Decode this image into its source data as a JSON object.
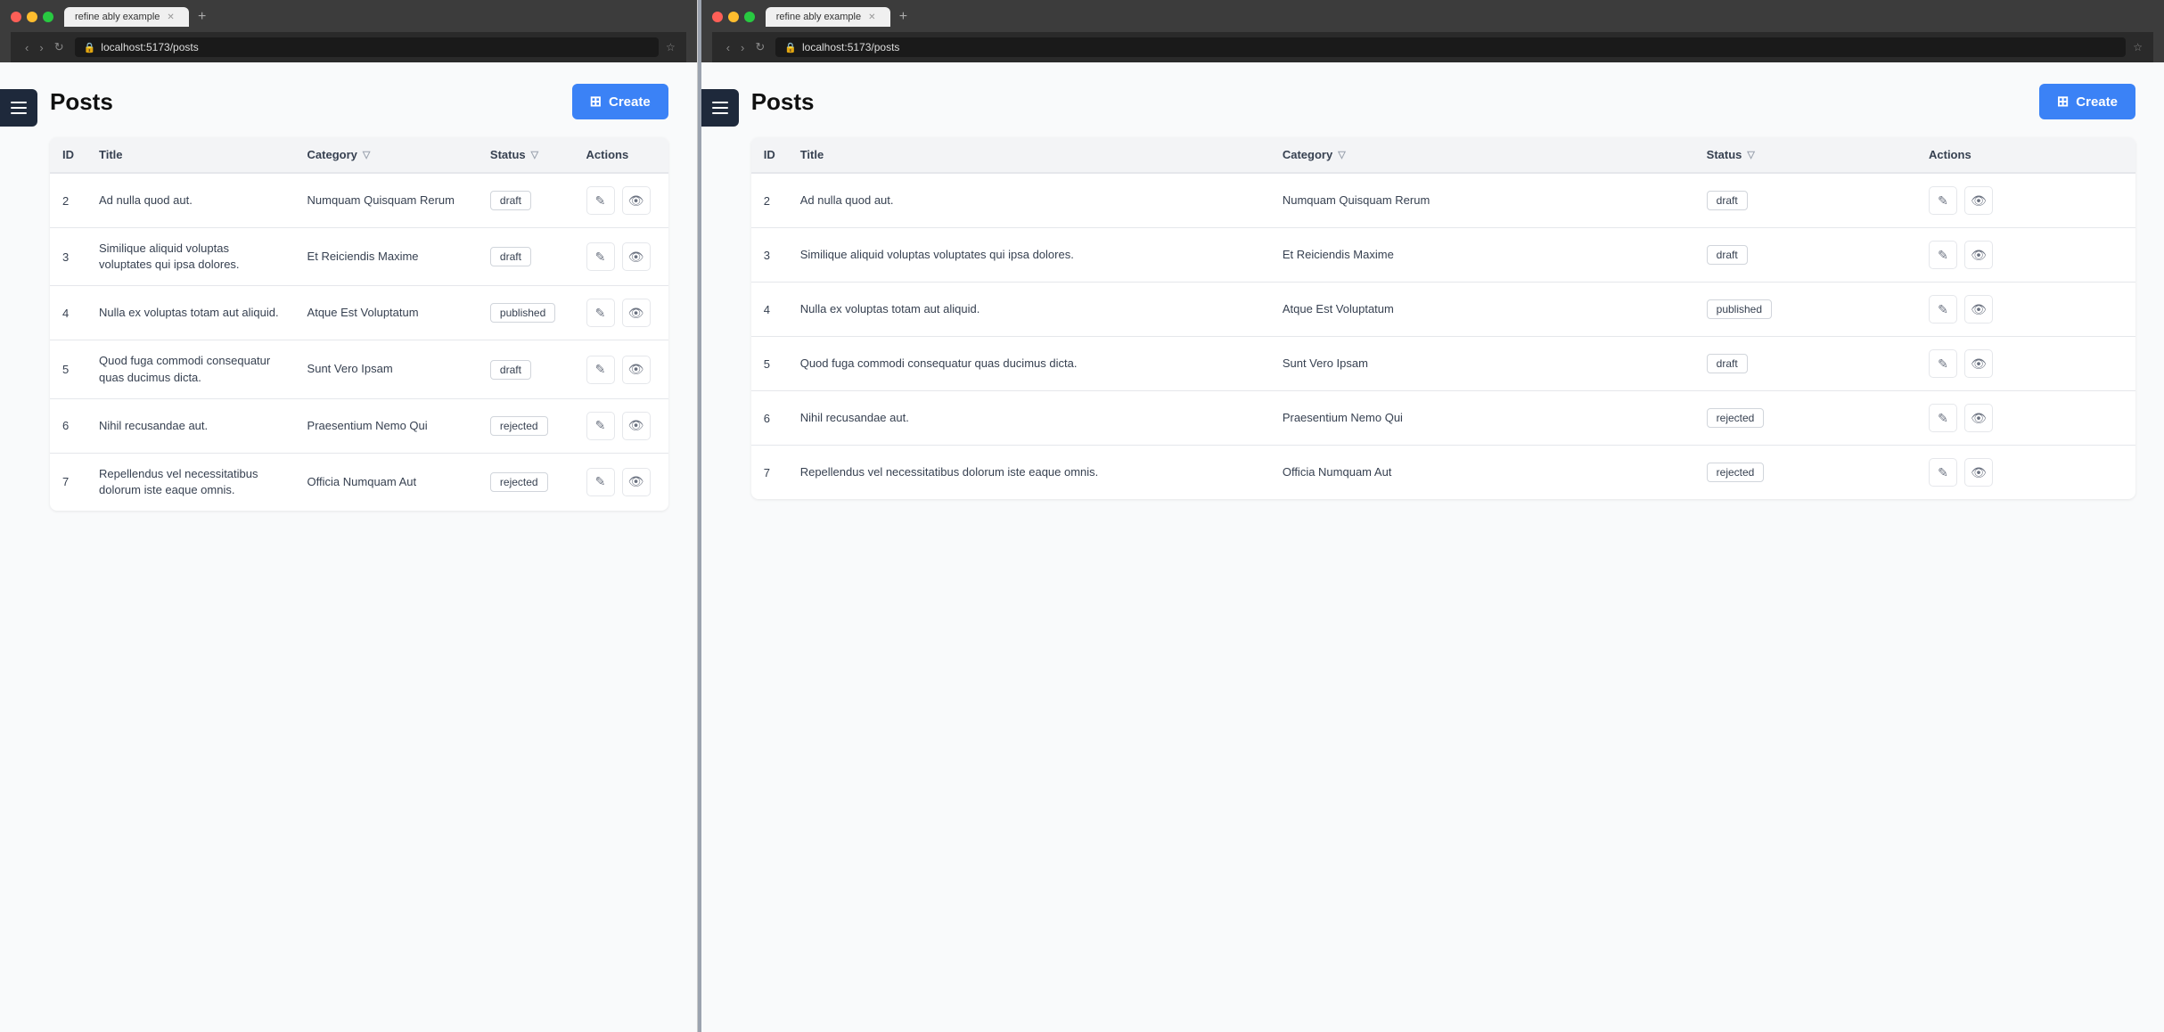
{
  "windows": [
    {
      "id": "left",
      "browser": {
        "tab_title": "refine ably example",
        "url": "localhost:5173/posts",
        "tab_plus": "+",
        "nav": {
          "back": "‹",
          "forward": "›",
          "reload": "↻"
        }
      },
      "page": {
        "title": "Posts",
        "create_btn": "Create",
        "table": {
          "columns": [
            "ID",
            "Title",
            "Category",
            "Status",
            "Actions"
          ],
          "rows": [
            {
              "id": "2",
              "title": "Ad nulla quod aut.",
              "category": "Numquam Quisquam Rerum",
              "status": "draft"
            },
            {
              "id": "3",
              "title": "Similique aliquid voluptas voluptates qui ipsa dolores.",
              "category": "Et Reiciendis Maxime",
              "status": "draft"
            },
            {
              "id": "4",
              "title": "Nulla ex voluptas totam aut aliquid.",
              "category": "Atque Est Voluptatum",
              "status": "published"
            },
            {
              "id": "5",
              "title": "Quod fuga commodi consequatur quas ducimus dicta.",
              "category": "Sunt Vero Ipsam",
              "status": "draft"
            },
            {
              "id": "6",
              "title": "Nihil recusandae aut.",
              "category": "Praesentium Nemo Qui",
              "status": "rejected"
            },
            {
              "id": "7",
              "title": "Repellendus vel necessitatibus dolorum iste eaque omnis.",
              "category": "Officia Numquam Aut",
              "status": "rejected"
            }
          ]
        }
      }
    },
    {
      "id": "right",
      "browser": {
        "tab_title": "refine ably example",
        "url": "localhost:5173/posts",
        "tab_plus": "+",
        "nav": {
          "back": "‹",
          "forward": "›",
          "reload": "↻"
        }
      },
      "page": {
        "title": "Posts",
        "create_btn": "Create",
        "table": {
          "columns": [
            "ID",
            "Title",
            "Category",
            "Status",
            "Actions"
          ],
          "rows": [
            {
              "id": "2",
              "title": "Ad nulla quod aut.",
              "category": "Numquam Quisquam Rerum",
              "status": "draft"
            },
            {
              "id": "3",
              "title": "Similique aliquid voluptas voluptates qui ipsa dolores.",
              "category": "Et Reiciendis Maxime",
              "status": "draft"
            },
            {
              "id": "4",
              "title": "Nulla ex voluptas totam aut aliquid.",
              "category": "Atque Est Voluptatum",
              "status": "published"
            },
            {
              "id": "5",
              "title": "Quod fuga commodi consequatur quas ducimus dicta.",
              "category": "Sunt Vero Ipsam",
              "status": "draft"
            },
            {
              "id": "6",
              "title": "Nihil recusandae aut.",
              "category": "Praesentium Nemo Qui",
              "status": "rejected"
            },
            {
              "id": "7",
              "title": "Repellendus vel necessitatibus dolorum iste eaque omnis.",
              "category": "Officia Numquam Aut",
              "status": "rejected"
            }
          ]
        }
      }
    }
  ],
  "icons": {
    "edit": "✎",
    "view": "👁",
    "filter": "⧖",
    "plus": "＋",
    "hamburger": "☰"
  }
}
